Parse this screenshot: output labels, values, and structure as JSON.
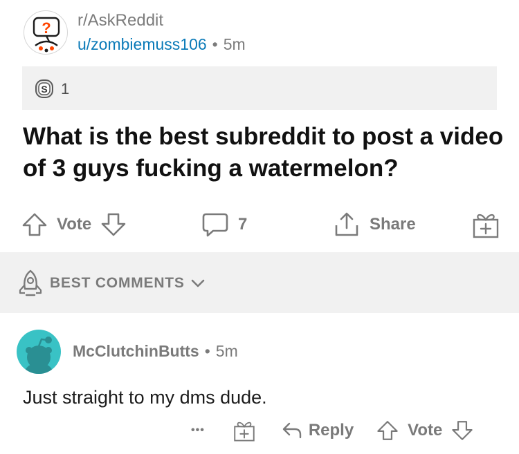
{
  "post": {
    "subreddit": "r/AskReddit",
    "author": "u/zombiemuss106",
    "separator": "•",
    "age": "5m",
    "award_count": "1",
    "title": "What is the best subreddit to post a video of 3 guys fucking a watermelon?"
  },
  "actions": {
    "vote_label": "Vote",
    "comment_count": "7",
    "share_label": "Share"
  },
  "sort": {
    "label": "BEST COMMENTS"
  },
  "comment": {
    "author": "McClutchinButts",
    "separator": "•",
    "age": "5m",
    "body": "Just straight to my dms dude.",
    "more_label": "•••",
    "reply_label": "Reply",
    "vote_label": "Vote"
  },
  "colors": {
    "link": "#0a7ab8",
    "muted": "#7a7a7a",
    "panel": "#f1f1f1",
    "avatar_teal": "#39c2c5",
    "accent_orange": "#ff4500"
  },
  "icons": [
    "askreddit-icon",
    "silver-award-icon",
    "upvote-icon",
    "downvote-icon",
    "comment-icon",
    "share-icon",
    "gift-icon",
    "rocket-icon",
    "chevron-down-icon",
    "reply-icon"
  ]
}
